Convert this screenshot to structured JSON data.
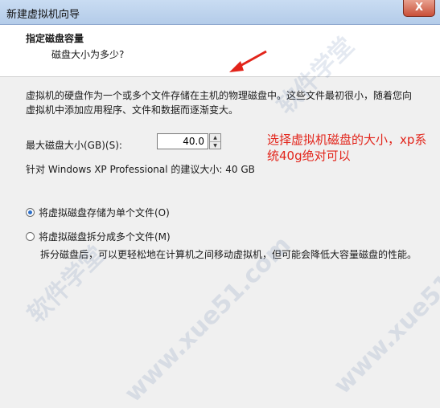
{
  "window": {
    "title": "新建虚拟机向导",
    "close_glyph": "X"
  },
  "header": {
    "title": "指定磁盘容量",
    "subtitle": "磁盘大小为多少?"
  },
  "content": {
    "description": "虚拟机的硬盘作为一个或多个文件存储在主机的物理磁盘中。这些文件最初很小，随着您向虚拟机中添加应用程序、文件和数据而逐渐变大。",
    "max_size_label": "最大磁盘大小(GB)(S):",
    "max_size_value": "40.0",
    "recommendation": "针对 Windows XP Professional 的建议大小: 40 GB",
    "options": [
      {
        "label": "将虚拟磁盘存储为单个文件(O)",
        "selected": true
      },
      {
        "label": "将虚拟磁盘拆分成多个文件(M)",
        "selected": false
      }
    ],
    "split_note": "拆分磁盘后，可以更轻松地在计算机之间移动虚拟机，但可能会降低大容量磁盘的性能。"
  },
  "annotation": {
    "text": "选择虚拟机磁盘的大小，xp系统40g绝对可以",
    "color": "#e2241a"
  },
  "watermarks": [
    "软件学堂",
    "www.xue51.com",
    "软件学堂",
    "www.xue51.com"
  ]
}
